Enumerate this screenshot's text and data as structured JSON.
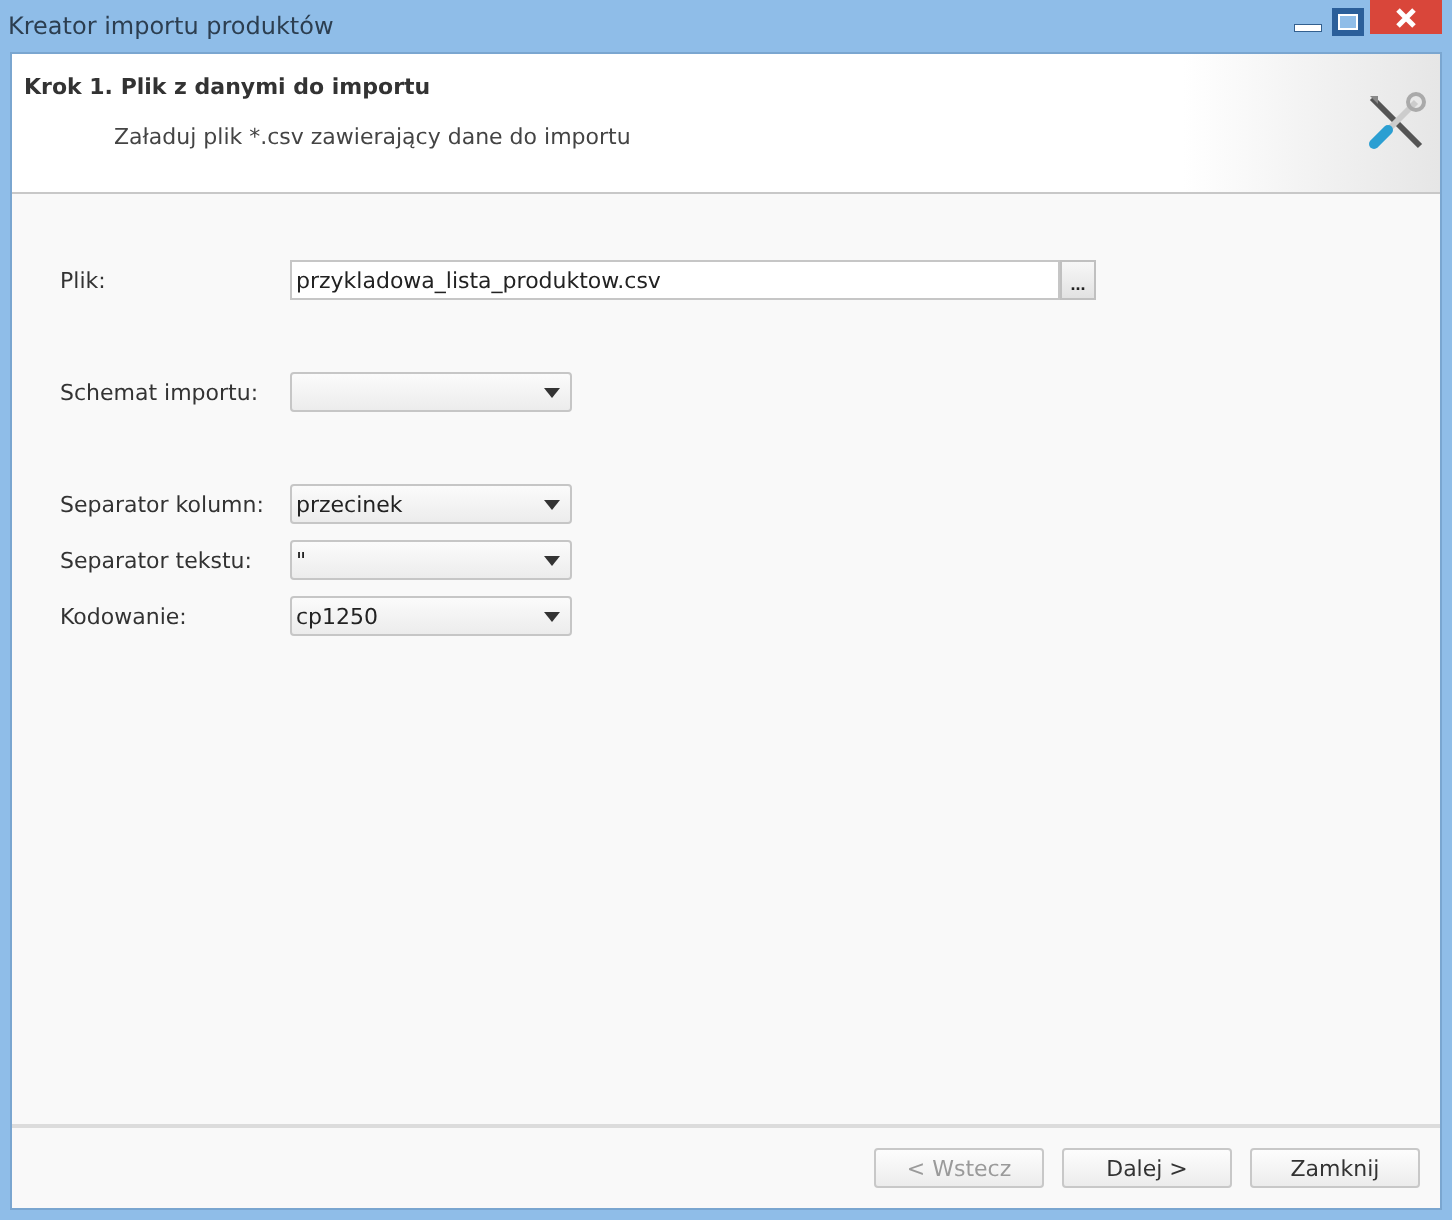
{
  "window": {
    "title": "Kreator importu produktów"
  },
  "header": {
    "title": "Krok 1. Plik z danymi do importu",
    "subtitle": "Załaduj plik *.csv zawierający dane do importu"
  },
  "field_groups": [
    [
      {
        "kind": "file",
        "label": "Plik:",
        "value": "przykladowa_lista_produktow.csv",
        "button": "..."
      }
    ],
    [
      {
        "kind": "select",
        "label": "Schemat importu:"
      }
    ],
    [
      {
        "kind": "select",
        "label": "Separator kolumn:",
        "value": "przecinek"
      },
      {
        "kind": "select",
        "label": "Separator tekstu:",
        "value": "\""
      },
      {
        "kind": "select",
        "label": "Kodowanie:",
        "value": "cp1250"
      }
    ]
  ],
  "buttons": [
    {
      "label": "< Wstecz",
      "disabled": true
    },
    {
      "label": "Dalej >",
      "disabled": false
    },
    {
      "label": "Zamknij",
      "disabled": false
    }
  ]
}
